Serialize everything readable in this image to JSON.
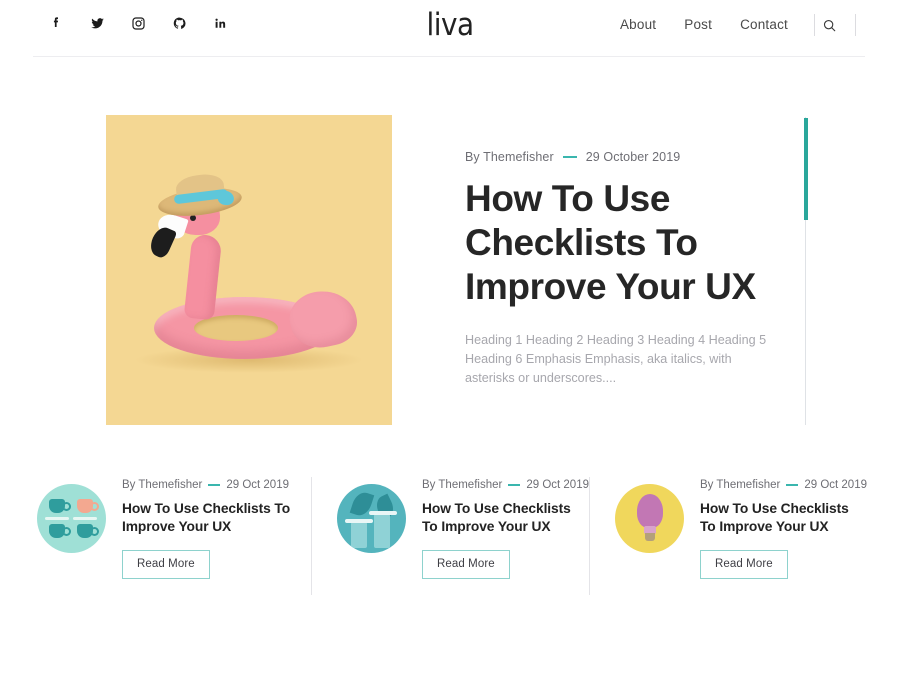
{
  "site": {
    "logo": "liva"
  },
  "header": {
    "social": [
      {
        "name": "facebook",
        "icon": "facebook-icon",
        "label": "Facebook"
      },
      {
        "name": "twitter",
        "icon": "twitter-icon",
        "label": "Twitter"
      },
      {
        "name": "instagram",
        "icon": "instagram-icon",
        "label": "Instagram"
      },
      {
        "name": "github",
        "icon": "github-icon",
        "label": "GitHub"
      },
      {
        "name": "linkedin",
        "icon": "linkedin-icon",
        "label": "LinkedIn"
      }
    ],
    "nav": [
      {
        "label": "About"
      },
      {
        "label": "Post"
      },
      {
        "label": "Contact"
      }
    ],
    "search_icon": "search-icon"
  },
  "hero": {
    "image_alt": "Pink inflatable flamingo float wearing a straw hat on a yellow background",
    "image_bg_color": "#f4d793",
    "author_prefix": "By",
    "author": "Themefisher",
    "author_line": "By Themefisher",
    "date": "29 October 2019",
    "title": "How To Use Checklists To Improve Your UX",
    "excerpt": "Heading 1 Heading 2 Heading 3 Heading 4 Heading 5 Heading 6 Emphasis Emphasis, aka italics, with asterisks or underscores....",
    "accent_color": "#2aa79b",
    "scrollbar": {
      "track_color": "#dfe2e6",
      "thumb_color": "#2aa79b"
    }
  },
  "cards": [
    {
      "author_line": "By Themefisher",
      "date": "29 Oct 2019",
      "title": "How To Use Checklists To Improve Your UX",
      "button_label": "Read More",
      "thumb_alt": "Teal coffee cups on mint background",
      "thumb_bg_color": "#9fe0d6"
    },
    {
      "author_line": "By Themefisher",
      "date": "29 Oct 2019",
      "title": "How To Use Checklists To Improve Your UX",
      "button_label": "Read More",
      "thumb_alt": "Teal pedestals with palm leaves",
      "thumb_bg_color": "#54b4bd"
    },
    {
      "author_line": "By Themefisher",
      "date": "29 Oct 2019",
      "title": "How To Use Checklists To Improve Your UX",
      "button_label": "Read More",
      "thumb_alt": "Pink glitter light bulb on yellow background",
      "thumb_bg_color": "#f0d75c"
    }
  ]
}
